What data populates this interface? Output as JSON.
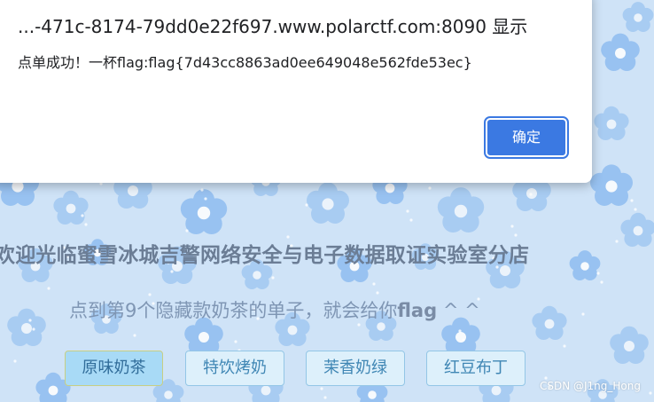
{
  "dialog": {
    "title": "...-471c-8174-79dd0e22f697.www.polarctf.com:8090 显示",
    "message": "点单成功！一杯flag:flag{7d43cc8863ad0ee649048e562fde53ec}",
    "ok_label": "确定"
  },
  "page": {
    "welcome": "欢迎光临蜜雪冰城吉警网络安全与电子数据取证实验室分店",
    "hint_prefix": "点到第9个隐藏款奶茶的单子，就会给你",
    "hint_bold": "flag",
    "hint_suffix": " ^ ^",
    "tea_buttons": [
      "原味奶茶",
      "特饮烤奶",
      "茉香奶绿",
      "红豆布丁"
    ],
    "watermark": "CSDN @J1ng_Hong"
  },
  "colors": {
    "background": "#cfe3f7",
    "flower": "#8fbdf0",
    "ok_button": "#3b79e2",
    "tea_button": "#ddf0fb",
    "tea_button_active": "#a8daf6"
  }
}
